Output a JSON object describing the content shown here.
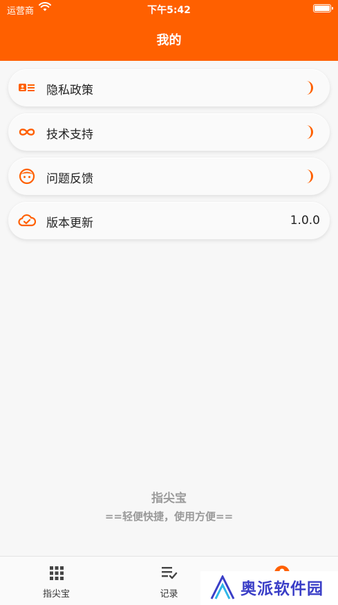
{
  "status_bar": {
    "carrier": "运营商",
    "time": "下午5:42"
  },
  "header": {
    "title": "我的"
  },
  "menu": [
    {
      "label": "隐私政策",
      "icon": "id-card-icon",
      "trailing": "chevron"
    },
    {
      "label": "技术支持",
      "icon": "infinity-icon",
      "trailing": "chevron"
    },
    {
      "label": "问题反馈",
      "icon": "face-icon",
      "trailing": "chevron"
    },
    {
      "label": "版本更新",
      "icon": "cloud-check-icon",
      "trailing": "value",
      "value": "1.0.0"
    }
  ],
  "footer": {
    "brand": "指尖宝",
    "slogan": "==轻便快捷，使用方便=="
  },
  "tabbar": [
    {
      "label": "指尖宝",
      "icon": "grid-icon"
    },
    {
      "label": "记录",
      "icon": "list-check-icon"
    },
    {
      "label": "",
      "icon": "user-icon"
    }
  ],
  "watermark": {
    "text": "奥派软件园"
  },
  "colors": {
    "accent": "#ff6000",
    "background": "#f7f7f7",
    "text": "#222222",
    "muted": "#9a9a9a"
  }
}
